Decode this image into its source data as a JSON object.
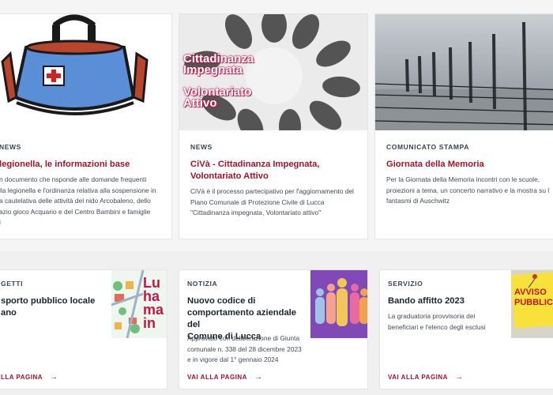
{
  "news": [
    {
      "category": "NEWS",
      "title": "legionella, le informazioni base",
      "desc": "n documento che nsponde alle domande frequenti\nlla legionella e l'ordinanza relativa alla sospensione in\na cautelativa delle attività del nido Arcobaleno, dello\nazio gioco Acquario e del Centro Bambini e famiglie\ni"
    },
    {
      "category": "NEWS",
      "title": "CiVà - Cittadinanza Impegnata,\nVolontariato Attivo",
      "desc": "CiVà è il processo partecipativo per l'aggiornamento del\nPiano Comunale di Protezione Civile di Lucca\n\"Cittadinanza impegnata, Volontariato attivo\"",
      "image_text": [
        "Cittadinanza",
        "Impegnata",
        "Volontariato",
        "Attivo"
      ]
    },
    {
      "category": "COMUNICATO STAMPA",
      "title": "Giornata della Memoria",
      "desc": "Per la Giornata della Memoria incontri con le scuole,\nproiezioni a tema, un concerto narrativo e la mostra su l\nfantasmi di Auschwitz"
    }
  ],
  "cards": [
    {
      "category": "GETTI",
      "title": "sporto pubblico locale\nano",
      "desc": "",
      "link": "LLA PAGINA",
      "thumb_text": [
        "Lu",
        "ha",
        "ma",
        "in"
      ]
    },
    {
      "category": "NOTIZIA",
      "title": "Nuovo codice di\ncomportamento aziendale del\nComune di Lucca",
      "desc": "Approvato con deliberazione di Giunta\ncomunale n. 338 del 28 dicembre 2023\ne in vigore dal 1° gennaio 2024",
      "link": "VAI ALLA PAGINA"
    },
    {
      "category": "SERVIZIO",
      "title": "Bando affitto 2023",
      "desc": "La graduatoria provvisoria dei\nbeneficiari e l'elenco degli esclusi",
      "link": "VAI ALLA PAGINA",
      "thumb_text": [
        "AVVISO",
        "PUBBLICO"
      ]
    }
  ],
  "colors": {
    "accent": "#a8112a",
    "heading": "#1b2430"
  }
}
